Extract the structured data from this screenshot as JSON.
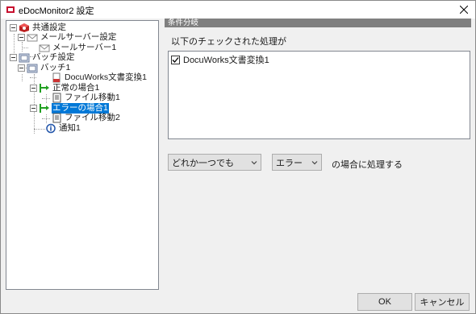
{
  "window": {
    "title": "eDocMonitor2 設定",
    "icon": "edocmonitor-app-icon",
    "close_icon": "close-icon"
  },
  "tree": {
    "nodes": [
      {
        "label": "共通設定",
        "icon": "common-settings-icon",
        "level": 0,
        "selected": false
      },
      {
        "label": "メールサーバー設定",
        "icon": "mail-icon",
        "level": 1,
        "selected": false
      },
      {
        "label": "メールサーバー1",
        "icon": "mail-icon",
        "level": 2,
        "selected": false
      },
      {
        "label": "バッチ設定",
        "icon": "batch-settings-icon",
        "level": 0,
        "selected": false
      },
      {
        "label": "バッチ1",
        "icon": "batch-icon",
        "level": 1,
        "selected": false
      },
      {
        "label": "DocuWorks文書変換1",
        "icon": "docuworks-document-icon",
        "level": 2,
        "selected": false
      },
      {
        "label": "正常の場合1",
        "icon": "branch-arrow-icon",
        "level": 2,
        "selected": false
      },
      {
        "label": "ファイル移動1",
        "icon": "file-move-icon",
        "level": 3,
        "selected": false
      },
      {
        "label": "エラーの場合1",
        "icon": "branch-arrow-icon",
        "level": 2,
        "selected": true
      },
      {
        "label": "ファイル移動2",
        "icon": "file-move-icon",
        "level": 3,
        "selected": false
      },
      {
        "label": "通知1",
        "icon": "notification-icon",
        "level": 2,
        "selected": false
      }
    ]
  },
  "panel": {
    "header": "条件分岐",
    "description": "以下のチェックされた処理が",
    "checked_items": [
      {
        "label": "DocuWorks文書変換1",
        "checked": true
      }
    ],
    "match_select": {
      "value": "どれか一つでも"
    },
    "status_select": {
      "value": "エラー"
    },
    "suffix": "の場合に処理する"
  },
  "buttons": {
    "ok": "OK",
    "cancel": "キャンセル"
  },
  "colors": {
    "selection": "#0078d7",
    "header_bg": "#7f7f7f",
    "arrow_green": "#22a022"
  }
}
